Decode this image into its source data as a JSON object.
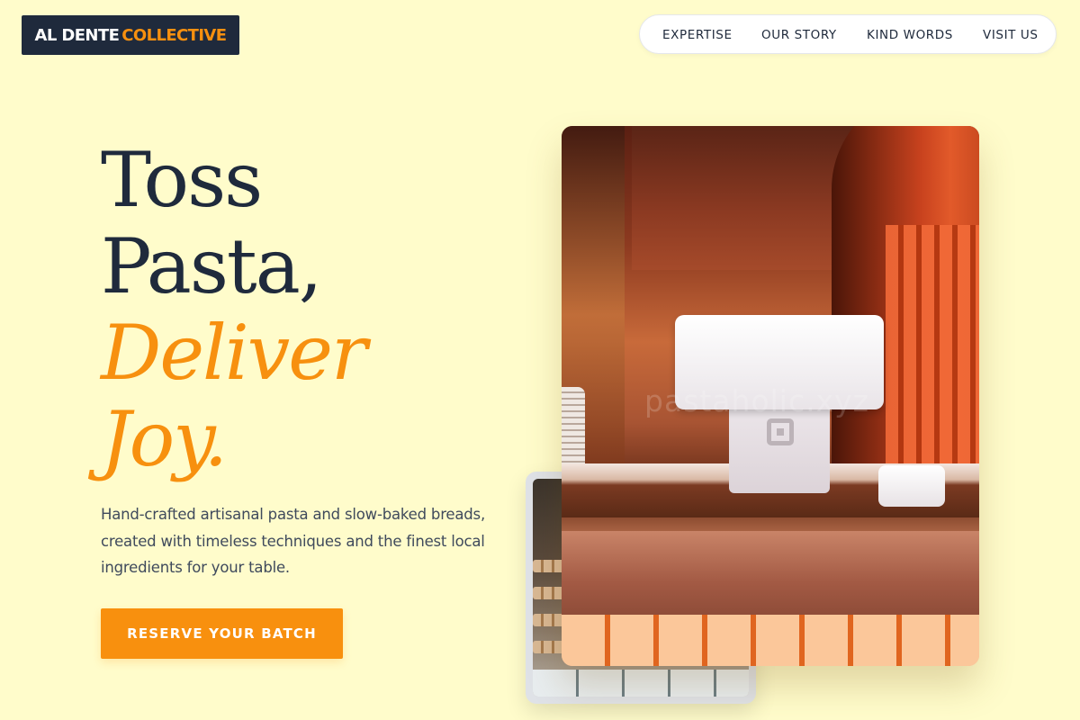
{
  "brand": {
    "name_part1": "AL DENTE",
    "name_part2": "COLLECTIVE"
  },
  "nav": {
    "items": [
      {
        "label": "EXPERTISE"
      },
      {
        "label": "OUR STORY"
      },
      {
        "label": "KIND WORDS"
      },
      {
        "label": "VISIT US"
      }
    ]
  },
  "hero": {
    "headline_line1": "Toss",
    "headline_line2": "Pasta,",
    "headline_line3": "Deliver",
    "headline_line4": "Joy.",
    "description": "Hand-crafted artisanal pasta and slow-baked breads, created with timeless techniques and the finest local ingredients for your table.",
    "cta_label": "RESERVE YOUR BATCH"
  },
  "media": {
    "main_photo_watermark": "pastaholic.xyz"
  },
  "colors": {
    "background": "#fffccb",
    "accent": "#f8900e",
    "dark": "#1f2a3c"
  }
}
